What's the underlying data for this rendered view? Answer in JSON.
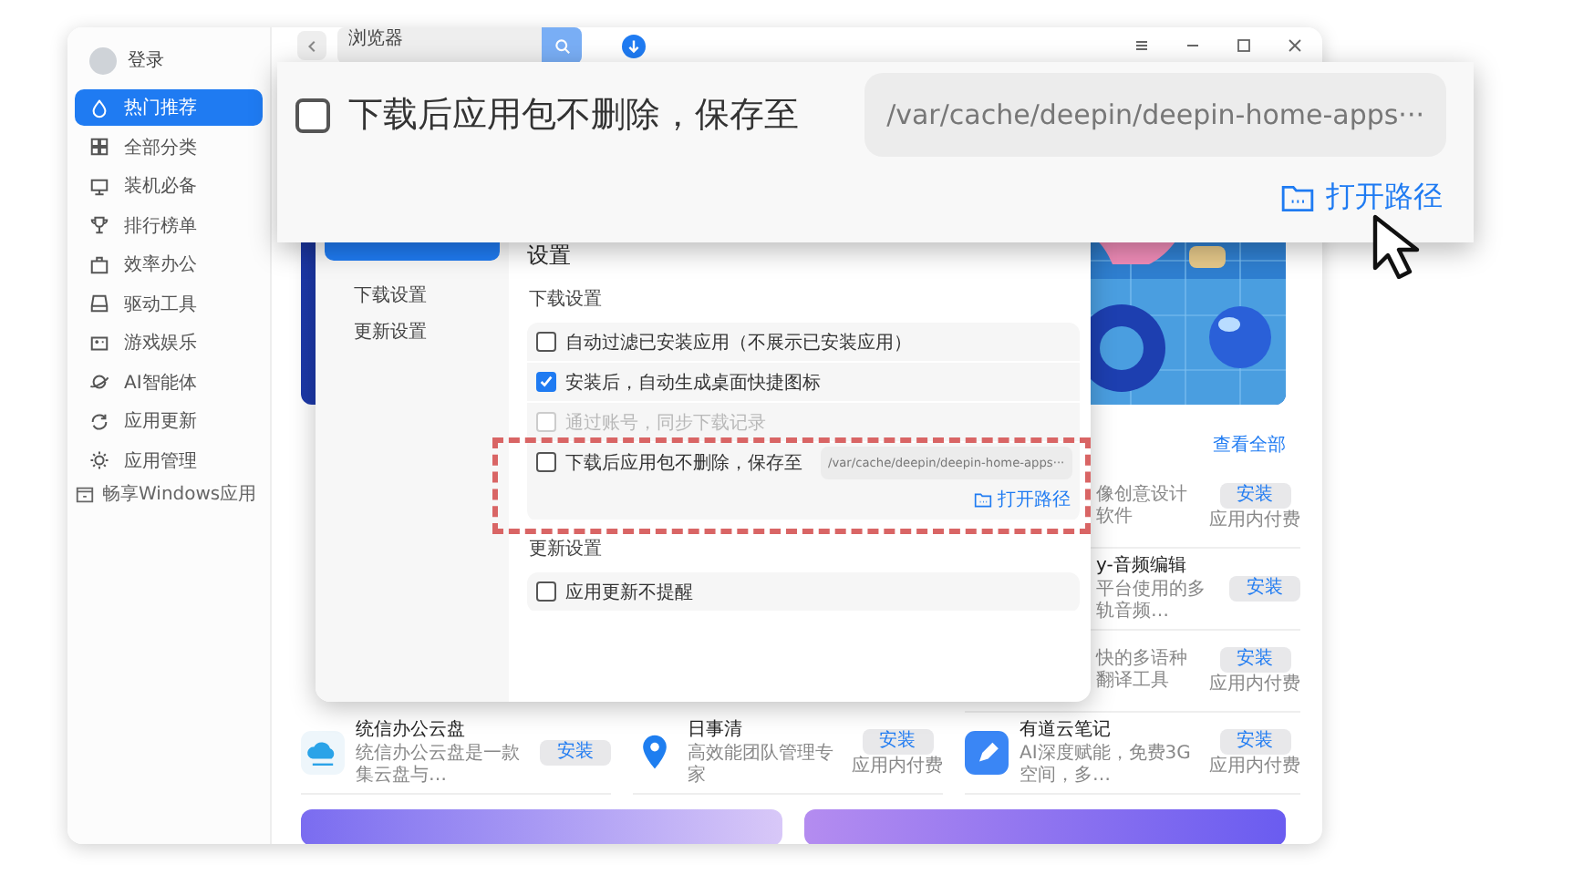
{
  "sidebar": {
    "login": "登录",
    "items": [
      {
        "label": "热门推荐",
        "selected": true
      },
      {
        "label": "全部分类",
        "selected": false
      },
      {
        "label": "装机必备",
        "selected": false
      },
      {
        "label": "排行榜单",
        "selected": false
      },
      {
        "label": "效率办公",
        "selected": false
      },
      {
        "label": "驱动工具",
        "selected": false
      },
      {
        "label": "游戏娱乐",
        "selected": false
      },
      {
        "label": "AI智能体",
        "selected": false
      },
      {
        "label": "应用更新",
        "selected": false
      },
      {
        "label": "应用管理",
        "selected": false
      }
    ],
    "footer": "畅享Windows应用"
  },
  "search": {
    "value": "浏览器"
  },
  "section": {
    "view_all": "查看全部"
  },
  "partial_apps": [
    {
      "description": "像创意设计软件",
      "button": "安装",
      "note": "应用内付费"
    },
    {
      "name": "y-音频编辑",
      "description": "平台使用的多轨音频…",
      "button": "安装"
    },
    {
      "description": "快的多语种翻译工具",
      "button": "安装",
      "note": "应用内付费"
    }
  ],
  "apps": [
    {
      "name": "统信办公云盘",
      "description": "统信办公云盘是一款集云盘与…",
      "button": "安装"
    },
    {
      "name": "日事清",
      "description": "高效能团队管理专家",
      "button": "安装",
      "note": "应用内付费"
    },
    {
      "name": "有道云笔记",
      "description": "AI深度赋能，免费3G空间，多…",
      "button": "安装",
      "note": "应用内付费"
    }
  ],
  "settings": {
    "nav": [
      {
        "label": "下载设置"
      },
      {
        "label": "更新设置"
      }
    ],
    "title": "设置",
    "sections": [
      {
        "heading": "下载设置",
        "options": [
          {
            "kind": "checkbox",
            "label": "自动过滤已安装应用（不展示已安装应用）",
            "checked": false,
            "disabled": false
          },
          {
            "kind": "checkbox",
            "label": "安装后，自动生成桌面快捷图标",
            "checked": true,
            "disabled": false
          },
          {
            "kind": "checkbox",
            "label": "通过账号，同步下载记录",
            "checked": false,
            "disabled": true
          },
          {
            "kind": "path",
            "label": "下载后应用包不删除，保存至",
            "checked": false,
            "disabled": false,
            "path": "/var/cache/deepin/deepin-home-apps···",
            "link": "打开路径"
          }
        ]
      },
      {
        "heading": "更新设置",
        "options": [
          {
            "kind": "checkbox",
            "label": "应用更新不提醒",
            "checked": false,
            "disabled": false
          }
        ]
      }
    ]
  },
  "callout": {
    "label": "下载后应用包不删除，保存至",
    "checked": false,
    "path": "/var/cache/deepin/deepin-home-apps···",
    "link": "打开路径"
  }
}
